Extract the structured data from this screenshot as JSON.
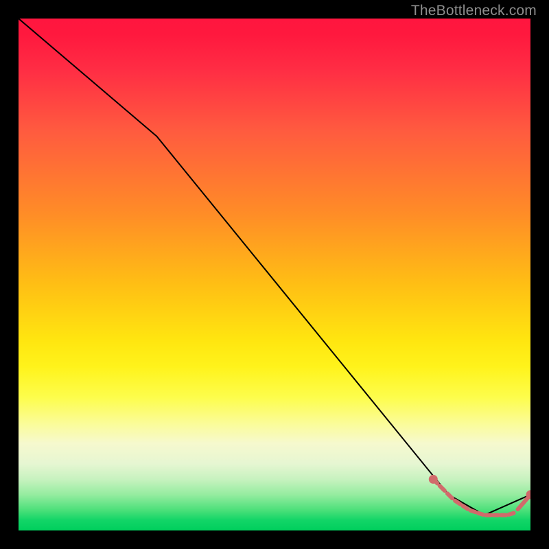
{
  "watermark": "TheBottleneck.com",
  "chart_data": {
    "type": "line",
    "title": "",
    "xlabel": "",
    "ylabel": "",
    "xlim": [
      0,
      100
    ],
    "ylim": [
      0,
      100
    ],
    "grid": false,
    "series": [
      {
        "name": "curve",
        "style": "solid-black",
        "x": [
          0,
          27,
          84,
          91,
          100
        ],
        "y": [
          100,
          77,
          7,
          3,
          7
        ]
      },
      {
        "name": "highlight-band",
        "style": "salmon-dashed-with-endpoints",
        "x": [
          81,
          82,
          83.5,
          85,
          86.5,
          88,
          89.5,
          91,
          92.5,
          94,
          95.5,
          97,
          100
        ],
        "y": [
          10,
          9,
          7.5,
          6,
          5,
          4,
          3.5,
          3,
          3,
          3,
          3,
          3.5,
          7
        ]
      }
    ]
  }
}
